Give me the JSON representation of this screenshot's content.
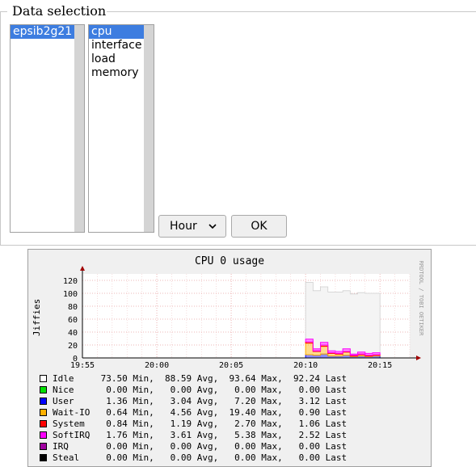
{
  "form": {
    "legend": "Data selection",
    "hosts": [
      {
        "label": "epsib2g21",
        "selected": true
      }
    ],
    "plugins": [
      {
        "label": "cpu",
        "selected": true
      },
      {
        "label": "interface",
        "selected": false
      },
      {
        "label": "load",
        "selected": false
      },
      {
        "label": "memory",
        "selected": false
      }
    ],
    "timespan": {
      "value": "Hour"
    },
    "ok_label": "OK"
  },
  "graph": {
    "watermark": "RRDTOOL / TOBI OETIKER",
    "legend": {
      "min": "Min,",
      "avg": "Avg,",
      "max": "Max,",
      "last": "Last",
      "rows": [
        {
          "name": "Idle",
          "color": "#ffffff",
          "min": "73.50",
          "avg": "88.59",
          "max": "93.64",
          "last": "92.24"
        },
        {
          "name": "Nice",
          "color": "#00e000",
          "min": "0.00",
          "avg": "0.00",
          "max": "0.00",
          "last": "0.00"
        },
        {
          "name": "User",
          "color": "#0000ff",
          "min": "1.36",
          "avg": "3.04",
          "max": "7.20",
          "last": "3.12"
        },
        {
          "name": "Wait-IO",
          "color": "#ffb000",
          "min": "0.64",
          "avg": "4.56",
          "max": "19.40",
          "last": "0.90"
        },
        {
          "name": "System",
          "color": "#ff0000",
          "min": "0.84",
          "avg": "1.19",
          "max": "2.70",
          "last": "1.06"
        },
        {
          "name": "SoftIRQ",
          "color": "#ff00ff",
          "min": "1.76",
          "avg": "3.61",
          "max": "5.38",
          "last": "2.52"
        },
        {
          "name": "IRQ",
          "color": "#a000a0",
          "min": "0.00",
          "avg": "0.00",
          "max": "0.00",
          "last": "0.00"
        },
        {
          "name": "Steal",
          "color": "#000000",
          "min": "0.00",
          "avg": "0.00",
          "max": "0.00",
          "last": "0.00"
        }
      ]
    }
  },
  "chart_data": {
    "type": "area",
    "title": "CPU 0 usage",
    "ylabel": "Jiffies",
    "xlabel": "",
    "x_ticks": [
      "19:55",
      "20:00",
      "20:05",
      "20:10",
      "20:15"
    ],
    "y_ticks": [
      0,
      20,
      40,
      60,
      80,
      100,
      120
    ],
    "ylim": [
      0,
      130
    ],
    "xlim": [
      "19:55",
      "20:17"
    ],
    "grid": true,
    "x": [
      "20:10:00",
      "20:10:30",
      "20:11:00",
      "20:11:30",
      "20:12:00",
      "20:12:30",
      "20:13:00",
      "20:13:30",
      "20:14:00",
      "20:14:30"
    ],
    "series": [
      {
        "name": "Idle",
        "color": "#ffffff",
        "values": [
          88,
          90,
          86,
          91,
          92,
          90,
          93,
          92,
          93,
          92
        ]
      },
      {
        "name": "User",
        "color": "#0000ff",
        "values": [
          5,
          4,
          6,
          3,
          3,
          4,
          2,
          3,
          2,
          3
        ]
      },
      {
        "name": "Wait-IO",
        "color": "#ffb000",
        "values": [
          18,
          6,
          12,
          4,
          3,
          5,
          1,
          2,
          1,
          1
        ]
      },
      {
        "name": "System",
        "color": "#ff0000",
        "values": [
          2,
          1,
          2,
          1,
          1,
          1,
          1,
          1,
          1,
          1
        ]
      },
      {
        "name": "SoftIRQ",
        "color": "#ff00ff",
        "values": [
          4,
          3,
          4,
          3,
          3,
          4,
          2,
          3,
          3,
          3
        ]
      }
    ]
  }
}
